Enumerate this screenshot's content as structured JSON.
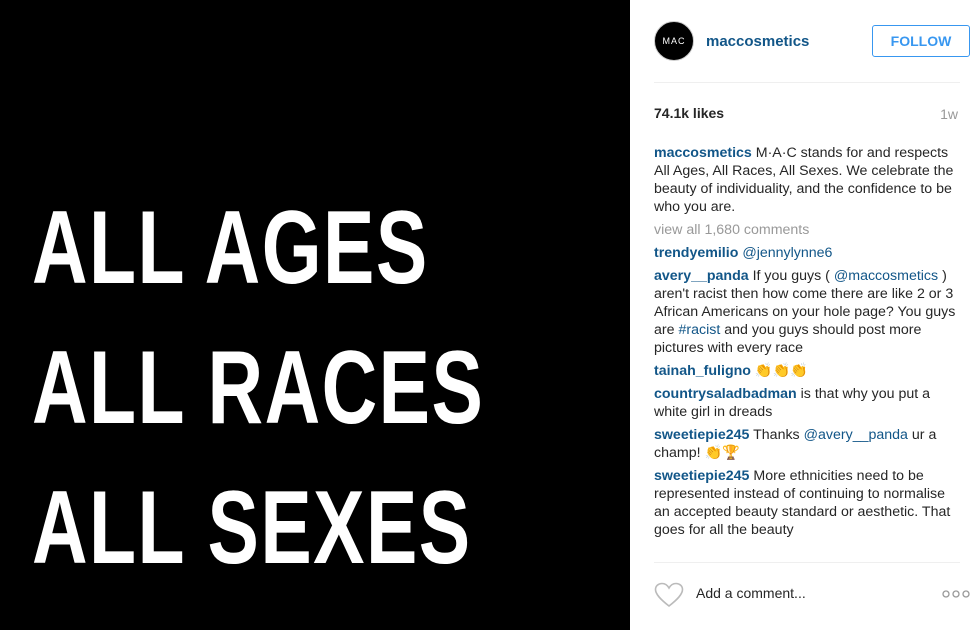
{
  "image": {
    "lines": [
      "ALL AGES",
      "ALL RACES",
      "ALL SEXES"
    ]
  },
  "header": {
    "avatar_text": "MAC",
    "username": "maccosmetics",
    "follow_label": "FOLLOW"
  },
  "stats": {
    "likes": "74.1k likes",
    "time": "1w"
  },
  "caption": {
    "user": "maccosmetics",
    "text": "M·A·C stands for and respects All Ages, All Races, All Sexes. We celebrate the beauty of individuality, and the confidence to be who you are."
  },
  "view_all": "view all 1,680 comments",
  "comments": [
    {
      "user": "trendyemilio",
      "text": "@jennylynne6"
    },
    {
      "user": "avery__panda",
      "text_1": "If you guys (",
      "mention": "@maccosmetics",
      "text_2": ") aren't racist then how come there are like 2 or 3 African Americans on your hole page? You guys are",
      "hashtag": "#racist",
      "text_3": "and you guys should post more pictures with every race"
    },
    {
      "user": "tainah_fuligno",
      "text": "👏👏👏"
    },
    {
      "user": "countrysaladbadman",
      "text": "is that why you put a white girl in dreads"
    },
    {
      "user": "sweetiepie245",
      "text_1": "Thanks",
      "mention": "@avery__panda",
      "text_2": "ur a champ! 👏🏆"
    },
    {
      "user": "sweetiepie245",
      "text": "More ethnicities need to be represented instead of continuing to normalise an accepted beauty standard or aesthetic. That goes for all the beauty"
    }
  ],
  "add_comment": {
    "placeholder": "Add a comment..."
  },
  "colors": {
    "link": "#125688",
    "follow": "#3897f0",
    "muted": "#999999",
    "image_bg": "#000000"
  },
  "icons": [
    "heart-icon",
    "more-options-icon"
  ]
}
